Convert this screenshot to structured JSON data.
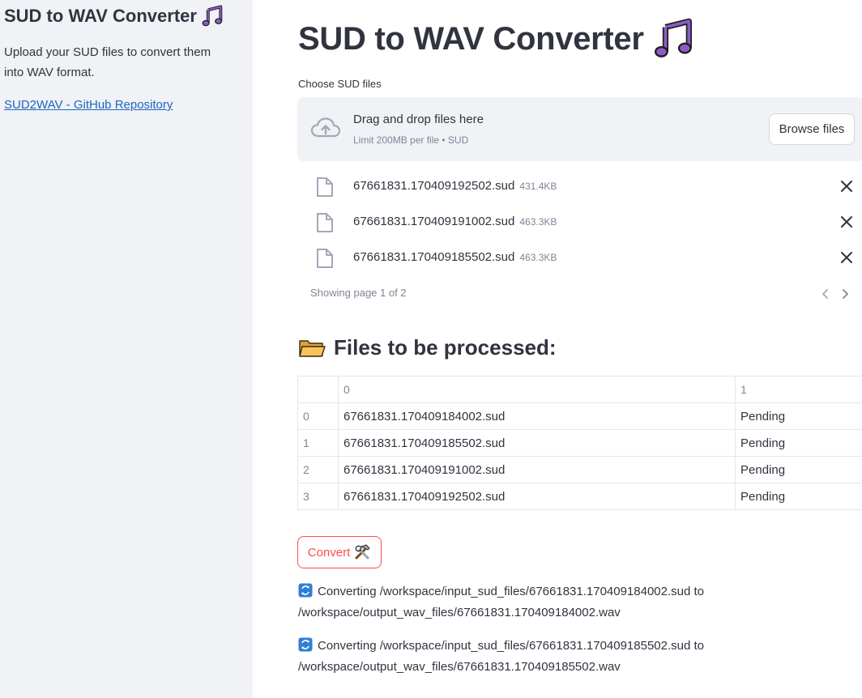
{
  "sidebar": {
    "title": "SUD to WAV Converter",
    "title_icon": "musical-notes-icon",
    "description": "Upload your SUD files to convert them into WAV format.",
    "link_text": "SUD2WAV - GitHub Repository"
  },
  "main": {
    "title": "SUD to WAV Converter",
    "title_icon": "musical-notes-icon"
  },
  "uploader": {
    "label": "Choose SUD files",
    "drop_text": "Drag and drop files here",
    "limit_text": "Limit 200MB per file • SUD",
    "browse_label": "Browse files",
    "files": [
      {
        "name": "67661831.170409192502.sud",
        "size": "431.4KB"
      },
      {
        "name": "67661831.170409191002.sud",
        "size": "463.3KB"
      },
      {
        "name": "67661831.170409185502.sud",
        "size": "463.3KB"
      }
    ],
    "pager_text": "Showing page 1 of 2"
  },
  "files_section": {
    "icon": "folder-icon",
    "title": "Files to be processed:",
    "columns": [
      "0",
      "1"
    ],
    "rows": [
      {
        "index": "0",
        "file": "67661831.170409184002.sud",
        "status": "Pending"
      },
      {
        "index": "1",
        "file": "67661831.170409185502.sud",
        "status": "Pending"
      },
      {
        "index": "2",
        "file": "67661831.170409191002.sud",
        "status": "Pending"
      },
      {
        "index": "3",
        "file": "67661831.170409192502.sud",
        "status": "Pending"
      }
    ]
  },
  "convert": {
    "label": "Convert",
    "icon": "hammer-wrench-icon"
  },
  "logs": [
    "Converting /workspace/input_sud_files/67661831.170409184002.sud to /workspace/output_wav_files/67661831.170409184002.wav",
    "Converting /workspace/input_sud_files/67661831.170409185502.sud to /workspace/output_wav_files/67661831.170409185502.wav"
  ],
  "colors": {
    "sidebar_bg": "#f0f2f6",
    "accent": "#ff4b4b",
    "link": "#1c66bf",
    "text": "#31333f",
    "muted": "#808495",
    "note_icon": "#8b5cc7"
  }
}
